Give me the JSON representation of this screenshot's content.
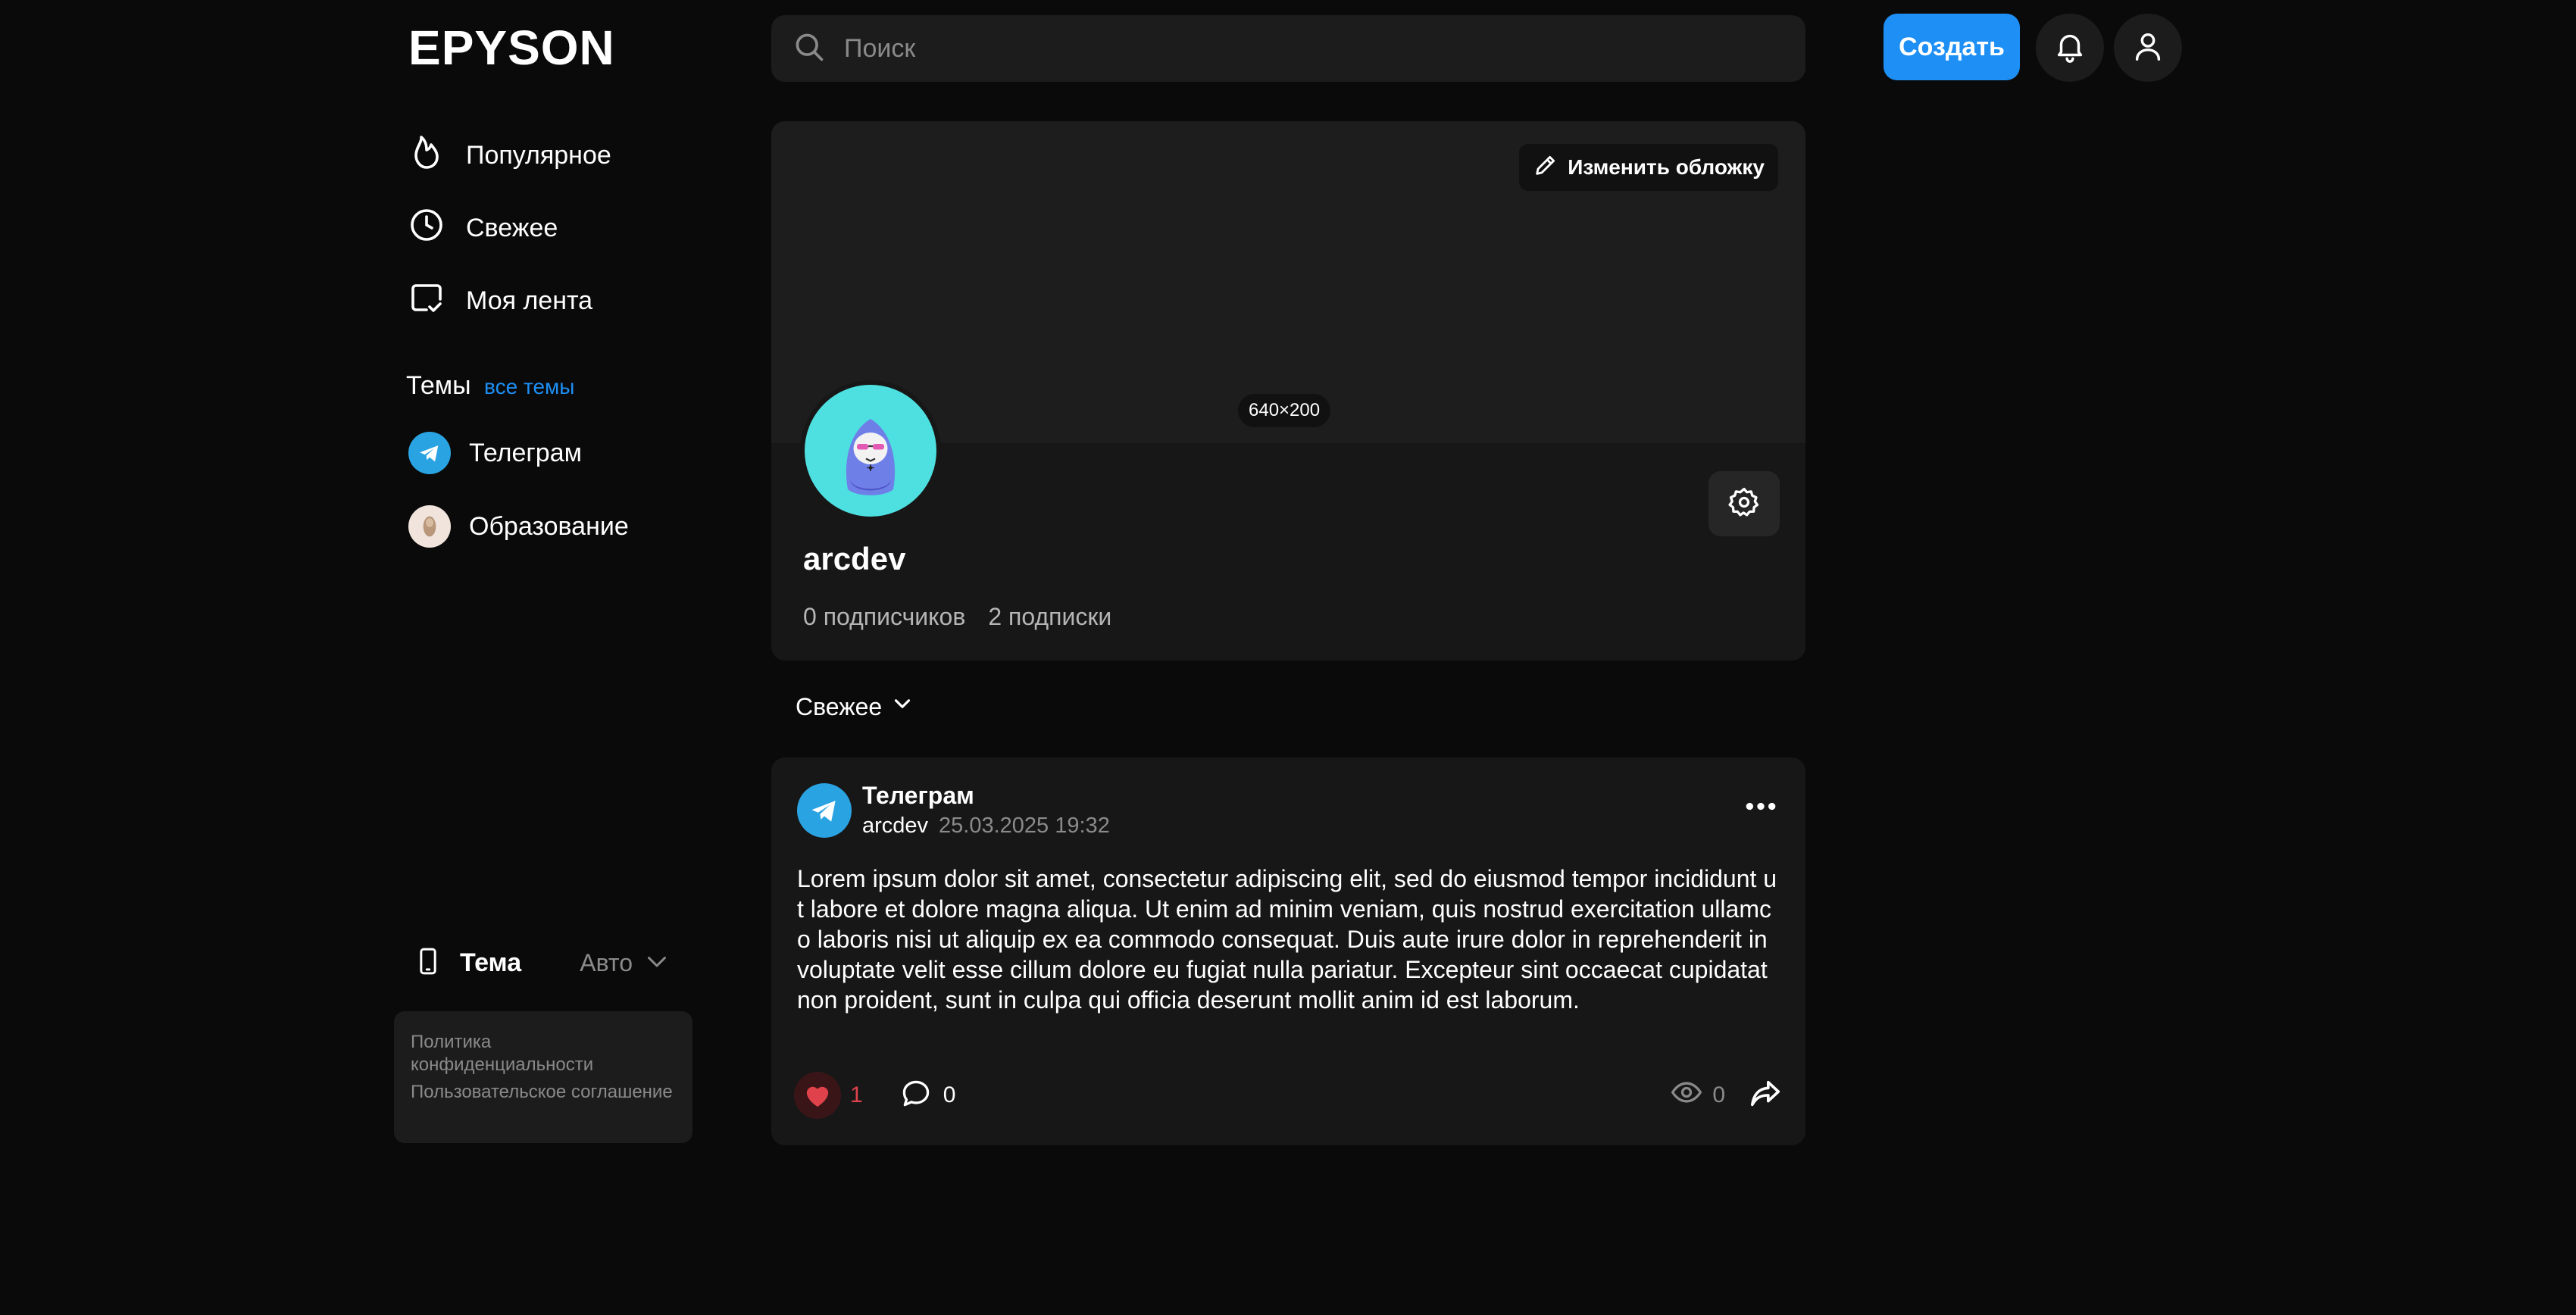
{
  "app": {
    "logo": "EPYSON"
  },
  "search": {
    "placeholder": "Поиск"
  },
  "header": {
    "create_label": "Создать"
  },
  "sidebar": {
    "nav": [
      {
        "label": "Популярное",
        "icon": "fire-icon"
      },
      {
        "label": "Свежее",
        "icon": "clock-icon"
      },
      {
        "label": "Моя лента",
        "icon": "feed-check-icon"
      }
    ],
    "topics_title": "Темы",
    "topics_all_link": "все темы",
    "topics": [
      {
        "label": "Телеграм",
        "icon": "telegram-icon"
      },
      {
        "label": "Образование",
        "icon": "education-avatar"
      }
    ],
    "theme_label": "Тема",
    "theme_value": "Авто",
    "legal": {
      "privacy": "Политика конфиденциальности",
      "terms": "Пользовательское соглашение"
    }
  },
  "profile": {
    "edit_cover_label": "Изменить обложку",
    "cover_size_badge": "640×200",
    "username": "arcdev",
    "followers": "0 подписчиков",
    "following": "2 подписки"
  },
  "feed": {
    "sort_label": "Свежее"
  },
  "post": {
    "topic": "Телеграм",
    "author": "arcdev",
    "date": "25.03.2025 19:32",
    "text": "Lorem ipsum dolor sit amet, consectetur adipiscing elit, sed do eiusmod tempor incididunt ut labore et dolore magna aliqua. Ut enim ad minim veniam, quis nostrud exercitation ullamco laboris nisi ut aliquip ex ea commodo consequat. Duis aute irure dolor in reprehenderit in voluptate velit esse cillum dolore eu fugiat nulla pariatur. Excepteur sint occaecat cupidatat non proident, sunt in culpa qui officia deserunt mollit anim id est laborum.",
    "likes": "1",
    "comments": "0",
    "views": "0"
  },
  "colors": {
    "accent": "#1d8ff5",
    "like": "#e0424b",
    "background": "#0a0a0a",
    "card": "#171717"
  }
}
